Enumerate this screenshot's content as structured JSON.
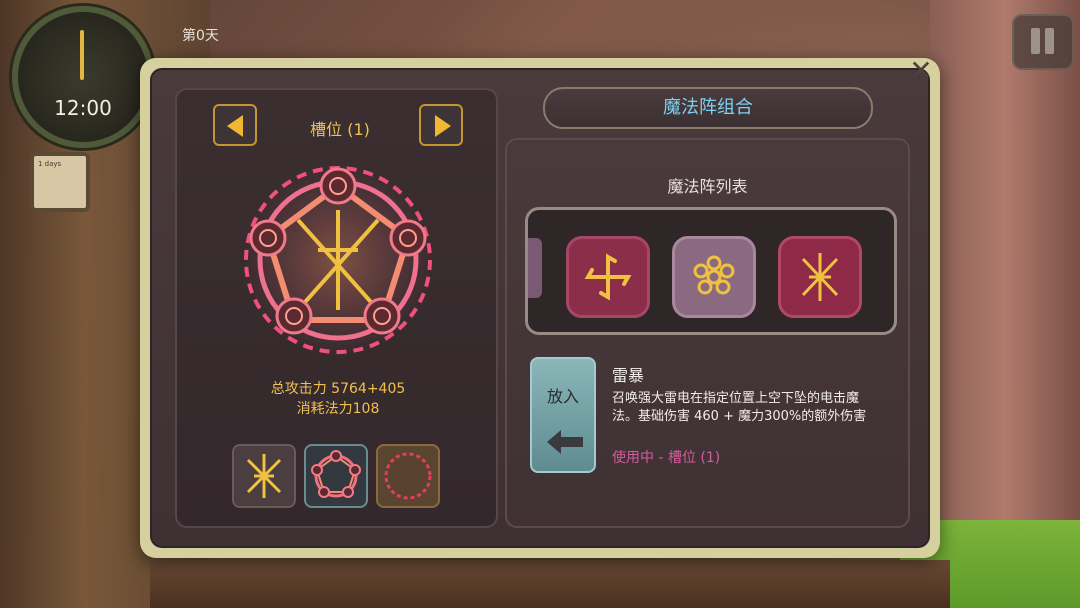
{
  "hud": {
    "time": "12:00",
    "day": "第0天",
    "note_text": "1 days",
    "icons": [
      "clock-icon",
      "note-icon",
      "pause-icon"
    ]
  },
  "dialog": {
    "title": "魔法阵组合",
    "close_icon": "close-icon",
    "left": {
      "slot_title": "槽位 (1)",
      "attack": "总攻击力 5764+405",
      "mana_cost": "消耗法力108",
      "equipped_icons": [
        "lightning-rune-icon",
        "pentagram-circle-icon",
        "empty-ring-icon"
      ]
    },
    "right": {
      "list_title": "魔法阵列表",
      "spells": [
        {
          "icon": "shuriken-icon",
          "color": "#8a2e4a"
        },
        {
          "icon": "flower-icon",
          "color": "#8a6a80"
        },
        {
          "icon": "lightning-rune-icon",
          "color": "#8e2a48"
        }
      ],
      "put_button": "放入",
      "spell_name": "雷暴",
      "spell_desc": "召唤强大雷电在指定位置上空下坠的电击魔法。基础伤害 460 + 魔力300%的额外伤害",
      "status": "使用中 - 槽位 (1)"
    }
  },
  "colors": {
    "gold": "#f0c050",
    "title_blue": "#7fd0f0",
    "status_pink": "#d45c9a"
  }
}
